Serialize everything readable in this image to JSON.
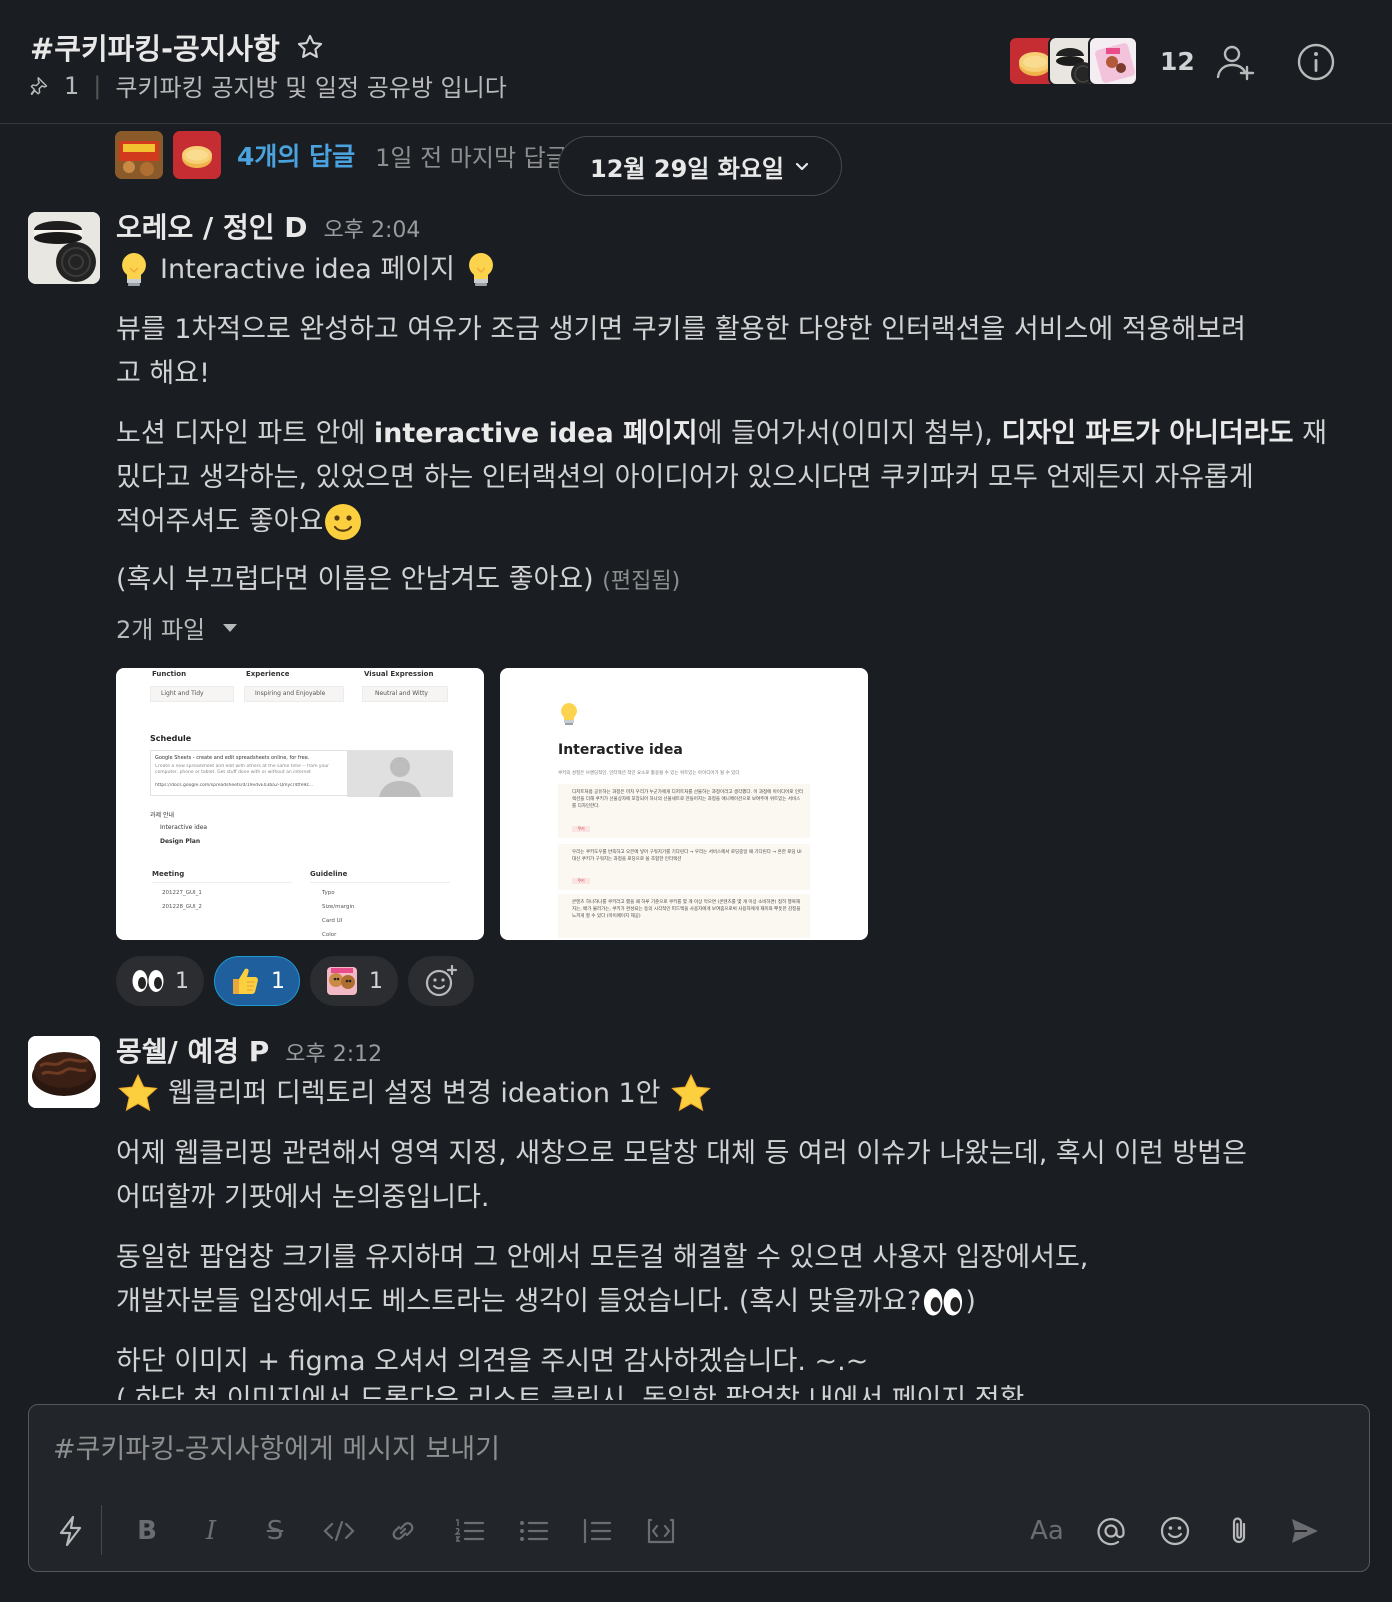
{
  "header": {
    "channel_name": "#쿠키파킹-공지사항",
    "pin_count": "1",
    "topic": "쿠키파킹 공지방 및 일정 공유방 입니다",
    "member_count": "12"
  },
  "thread_summary": {
    "reply_link": "4개의 답글",
    "last_reply": "1일 전 마지막 답글"
  },
  "date_divider": "12월 29일 화요일",
  "message1": {
    "author": "오레오 / 정인 D",
    "time": "오후 2:04",
    "title_text": "Interactive idea 페이지",
    "p1_line1": "뷰를 1차적으로 완성하고 여유가 조금 생기면 쿠키를 활용한 다양한 인터랙션을 서비스에 적용해보려",
    "p1_line2": "고 해요!",
    "p2_a": "노션 디자인 파트 안에 ",
    "p2_b": "interactive idea 페이지",
    "p2_c": "에 들어가서(이미지 첨부), ",
    "p2_d": "디자인 파트가 아니더라도",
    "p2_e": " 재",
    "p2_line2": "밌다고 생각하는, 있었으면 하는 인터랙션의 아이디어가 있으시다면 쿠키파커 모두 언제든지 자유롭게",
    "p2_line3": "적어주셔도 좋아요",
    "p3": "(혹시 부끄럽다면 이름은 안남겨도 좋아요)",
    "edited": "(편집됨)",
    "files_label": "2개 파일",
    "thumb1": {
      "col1": "Function",
      "col2": "Experience",
      "col3": "Visual Expression",
      "tag1": "Light and Tidy",
      "tag2": "Inspiring and Enjoyable",
      "tag3": "Neutral and Witty",
      "schedule": "Schedule",
      "sheet_title": "Google Sheets - create and edit spreadsheets online, for free.",
      "sheet_desc": "Create a new spreadsheet and edit with others at the same time -- from your computer, phone or tablet. Get stuff done with or without an internet",
      "sheet_url": "https://docs.google.com/spreadsheets/d/19vdvE03ba2-Qmycr4tfe9z...",
      "item1": "과제 안내",
      "item2": "Interactive idea",
      "item3": "Design Plan",
      "meeting": "Meeting",
      "guideline": "Guideline",
      "m1": "201227_GUI_1",
      "m2": "201228_GUI_2",
      "g1": "Typo",
      "g2": "Size/margin",
      "g3": "Card UI",
      "g4": "Color"
    },
    "thumb2": {
      "title": "Interactive idea",
      "intro": "쿠키의 성질은 브랜딩적인, 인터랙션 적인 요소로 활용될 수 있는 위트있는 아이디어가 될 수 있다",
      "c1": "디저트처럼 공유하는 과정은 마치 우리가 누군가에게 디저트처를 선물하는 과정이라고 생각했다. 이 과정에 아이디어로 인터랙션을 더해 쿠키가 선물상자에 포장되어 하나의 선물세트로 만들어지는 과정을 애니메이션으로 보여주며 위트있는 서비스를 디자인한다.",
      "c2": "우리는 쿠키도우를 반죽하고 오븐에 넣어 구워지기를 기다린다 → 우리는 서비스에서 로딩중일 때 기다린다 → 흔한 로딩 UI대신 쿠키가 구워지는 과정을 로딩으로 쓸 조합한 인터랙션",
      "c3": "콘텐츠 하나하나를 쿠키라고 했을 때 하루 기준으로 쿠키를 몇 개 이상 먹으면 (콘텐츠를 몇 개 이상 소비하면) 접히 행복해지는, 배가 불러가는, 쿠키가 완성되는 등의 시각적인 피드백을 사용자에게 보여줌으로써 사용자에게 재미와 뿌듯한 감정을 느끼게 할 수 있다 (마이페이지 제공)",
      "tag": "쿠키"
    },
    "reactions": [
      {
        "icon": "eyes-emoji",
        "count": "1"
      },
      {
        "icon": "thumbs-up-emoji",
        "count": "1"
      },
      {
        "icon": "cookie-custom-emoji",
        "count": "1"
      }
    ]
  },
  "message2": {
    "author": "몽쉘/ 예경 P",
    "time": "오후 2:12",
    "title_text": "웹클리퍼 디렉토리 설정 변경 ideation 1안",
    "p1_line1": "어제 웹클리핑 관련해서 영역 지정, 새창으로 모달창 대체 등 여러 이슈가 나왔는데, 혹시 이런 방법은",
    "p1_line2": "어떠할까 기팟에서 논의중입니다.",
    "p2_line1": "동일한 팝업창 크기를 유지하며 그 안에서 모든걸 해결할 수 있으면 사용자 입장에서도,",
    "p2_line2a": "개발자분들 입장에서도 베스트라는 생각이 들었습니다. (혹시 맞을까요? ",
    "p2_line2b": ")",
    "p3": "하단 이미지 + figma 오셔서 의견을 주시면 감사하겠습니다. ~.~",
    "p4_partial": "( 하단 첫 이미지에서 드롭다운 리스트 클릭시, 동일한 팝업창 내에서 페이지 전환"
  },
  "composer": {
    "placeholder": "#쿠키파킹-공지사항에게 메시지 보내기",
    "text_format_label": "Aa"
  },
  "colors": {
    "background": "#1a1d21",
    "link": "#4aa3df",
    "active_reaction": "#1f5f9e"
  }
}
